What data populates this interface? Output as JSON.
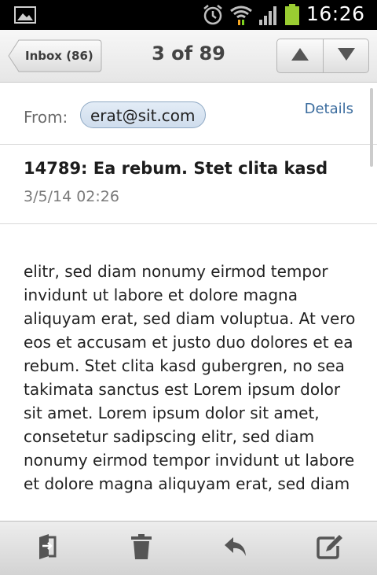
{
  "status_bar": {
    "time": "16:26",
    "icons": [
      "gallery-icon",
      "alarm-icon",
      "wifi-icon",
      "signal-icon",
      "battery-icon"
    ],
    "battery_color": "#9acd32"
  },
  "header": {
    "back_label": "Inbox (86)",
    "pager": "3 of 89",
    "prev_icon": "triangle-up-icon",
    "next_icon": "triangle-down-icon"
  },
  "message": {
    "from_label": "From:",
    "sender": "erat@sit.com",
    "details_label": "Details",
    "subject": "14789: Ea rebum. Stet clita kasd",
    "date": "3/5/14 02:26",
    "body": "elitr, sed diam nonumy eirmod tempor invidunt ut labore et dolore magna aliquyam erat, sed diam voluptua. At vero eos et accusam et justo duo dolores et ea rebum. Stet clita kasd gubergren, no sea takimata sanctus est Lorem ipsum dolor sit amet. Lorem ipsum dolor sit amet, consetetur sadipscing elitr, sed diam nonumy eirmod tempor invidunt ut labore et dolore magna aliquyam erat, sed diam"
  },
  "toolbar": {
    "icons": [
      "move-icon",
      "trash-icon",
      "reply-icon",
      "compose-icon"
    ]
  },
  "colors": {
    "chip_border": "#8fa9c4",
    "link": "#3b6c9e",
    "toolbar_icon": "#555555"
  }
}
